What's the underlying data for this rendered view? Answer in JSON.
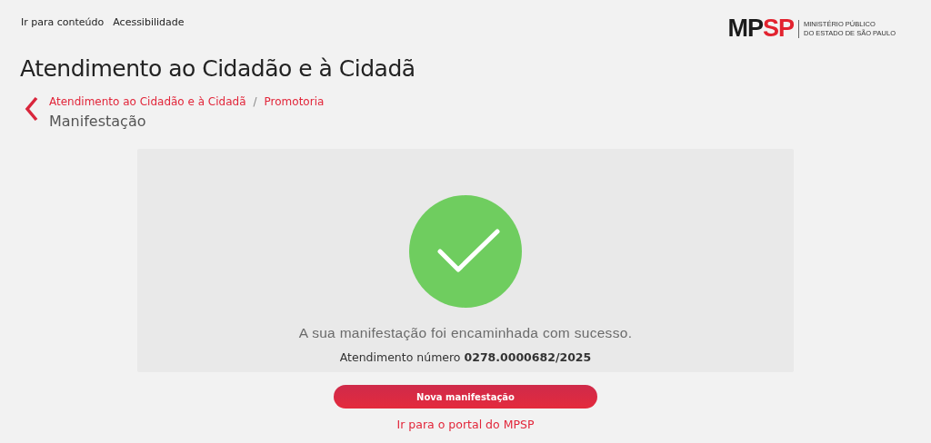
{
  "skip_links": [
    "Ir para conteúdo",
    "Acessibilidade"
  ],
  "logo": {
    "mark": [
      "MP",
      "SP"
    ],
    "lines": [
      "MINISTÉRIO PÚBLICO",
      "DO ESTADO DE SÃO PAULO"
    ]
  },
  "title": "Atendimento ao Cidadão e à Cidadã",
  "breadcrumb": {
    "links": [
      "Atendimento ao Cidadão e à Cidadã",
      "Promotoria"
    ],
    "separator": "/",
    "current": "Manifestação"
  },
  "result": {
    "message": "A sua manifestação foi encaminhada com sucesso.",
    "number": "Atendimento número **0278.0000682/2025**"
  },
  "button": "Nova manifestação",
  "portal_link": "Ir para o portal do MPSP"
}
